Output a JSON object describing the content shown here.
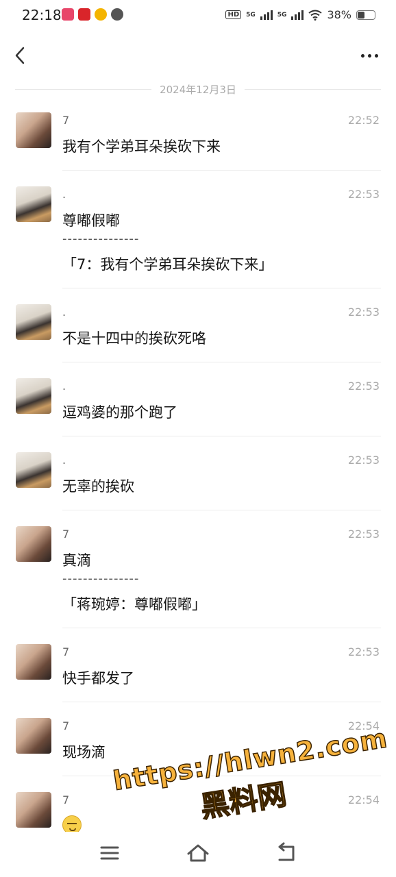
{
  "status": {
    "time": "22:18",
    "network_a": "5G",
    "network_b": "5G",
    "battery": "38%",
    "battery_level": 0.38,
    "hd_label": "HD"
  },
  "header": {
    "back_icon": "chevron-left-icon",
    "more_icon": "more-dots-icon"
  },
  "date_separator": "2024年12月3日",
  "messages": [
    {
      "nick": "7",
      "time": "22:52",
      "text": "我有个学弟耳朵挨砍下来",
      "avatar": "man-portrait"
    },
    {
      "nick": ".",
      "time": "22:53",
      "text": "尊嘟假嘟",
      "dashes": "---------------",
      "quote": "「7：我有个学弟耳朵挨砍下来」",
      "avatar": "person-with-cat"
    },
    {
      "nick": ".",
      "time": "22:53",
      "text": "不是十四中的挨砍死咯",
      "avatar": "person-with-cat"
    },
    {
      "nick": ".",
      "time": "22:53",
      "text": "逗鸡婆的那个跑了",
      "avatar": "person-with-cat"
    },
    {
      "nick": ".",
      "time": "22:53",
      "text": "无辜的挨砍",
      "avatar": "person-with-cat"
    },
    {
      "nick": "7",
      "time": "22:53",
      "text": "真滴",
      "dashes": "---------------",
      "quote": "「蒋琬婷：尊嘟假嘟」",
      "avatar": "man-portrait"
    },
    {
      "nick": "7",
      "time": "22:53",
      "text": "快手都发了",
      "avatar": "man-portrait"
    },
    {
      "nick": "7",
      "time": "22:54",
      "text": "现场滴",
      "avatar": "man-portrait"
    },
    {
      "nick": "7",
      "time": "22:54",
      "text": "",
      "emoji": "grimace-emoji",
      "avatar": "man-portrait"
    }
  ],
  "watermark": {
    "url": "https://hlwn2.com",
    "label": "黑料网"
  },
  "bottom_nav": {
    "menu_icon": "menu-icon",
    "home_icon": "home-icon",
    "back_icon": "return-icon"
  }
}
